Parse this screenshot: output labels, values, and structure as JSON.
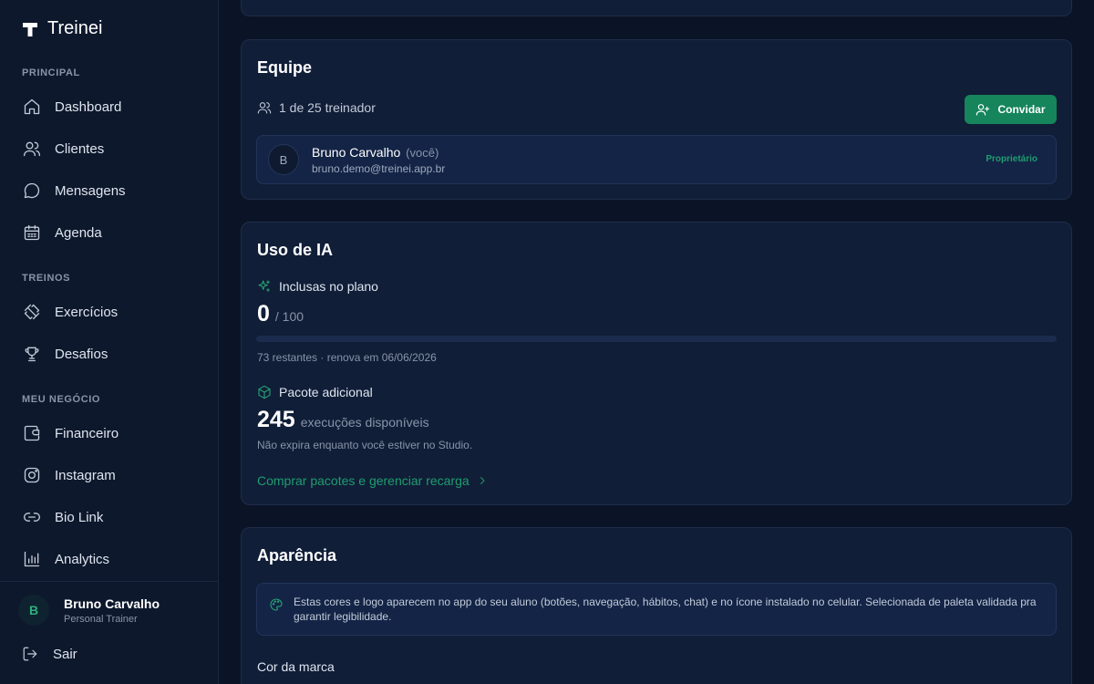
{
  "brand": {
    "name": "Treinei",
    "icon": "brand-t-icon"
  },
  "sidebar": {
    "sections": [
      {
        "label": "PRINCIPAL"
      },
      {
        "label": "TREINOS"
      },
      {
        "label": "MEU NEGÓCIO"
      }
    ],
    "items": [
      {
        "label": "Dashboard",
        "icon": "home-icon"
      },
      {
        "label": "Clientes",
        "icon": "users-icon"
      },
      {
        "label": "Mensagens",
        "icon": "message-icon"
      },
      {
        "label": "Agenda",
        "icon": "calendar-icon"
      },
      {
        "label": "Exercícios",
        "icon": "dumbbell-icon"
      },
      {
        "label": "Desafios",
        "icon": "trophy-icon"
      },
      {
        "label": "Financeiro",
        "icon": "wallet-icon"
      },
      {
        "label": "Instagram",
        "icon": "instagram-icon"
      },
      {
        "label": "Bio Link",
        "icon": "link-icon"
      },
      {
        "label": "Analytics",
        "icon": "bar-chart-icon"
      }
    ],
    "user": {
      "initial": "B",
      "name": "Bruno Carvalho",
      "role": "Personal Trainer"
    },
    "logout": {
      "label": "Sair",
      "icon": "logout-icon"
    }
  },
  "equipe": {
    "title": "Equipe",
    "count_text": "1 de 25 treinador",
    "invite_label": "Convidar",
    "member": {
      "initial": "B",
      "name": "Bruno Carvalho",
      "you_tag": "(você)",
      "email": "bruno.demo@treinei.app.br",
      "role": "Proprietário"
    }
  },
  "ia": {
    "title": "Uso de IA",
    "plan_label": "Inclusas no plano",
    "plan_used": "0",
    "plan_total": "/ 100",
    "plan_progress": 0,
    "plan_meta": "73 restantes · renova em 06/06/2026",
    "addon_label": "Pacote adicional",
    "addon_count": "245",
    "addon_unit": "execuções disponíveis",
    "addon_note": "Não expira enquanto você estiver no Studio.",
    "link_label": "Comprar pacotes e gerenciar recarga"
  },
  "aparencia": {
    "title": "Aparência",
    "info_text": "Estas cores e logo aparecem no app do seu aluno (botões, navegação, hábitos, chat) e no ícone instalado no celular. Selecionada de paleta validada pra garantir legibilidade.",
    "brand_color_label": "Cor da marca"
  },
  "colors": {
    "accent": "#16855c",
    "accent_text": "#1f9d6e",
    "background": "#0b1426",
    "card": "#101e38"
  }
}
